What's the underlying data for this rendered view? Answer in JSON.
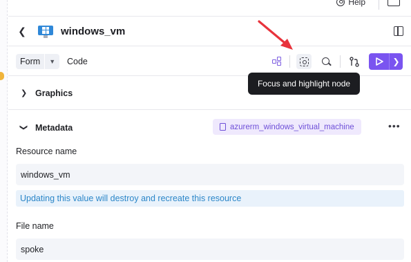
{
  "topbar": {
    "help_label": "Help"
  },
  "header": {
    "title": "windows_vm"
  },
  "toolbar": {
    "form_label": "Form",
    "code_label": "Code"
  },
  "tooltip": {
    "text": "Focus and highlight node"
  },
  "sections": {
    "graphics": {
      "title": "Graphics"
    },
    "metadata": {
      "title": "Metadata",
      "resource_type": "azurerm_windows_virtual_machine"
    }
  },
  "fields": {
    "resource_name": {
      "label": "Resource name",
      "value": "windows_vm",
      "note": "Updating this value will destroy and recreate this resource"
    },
    "file_name": {
      "label": "File name",
      "value": "spoke"
    }
  },
  "colors": {
    "accent": "#7a54f0",
    "chip_text": "#6e4fd8",
    "note_text": "#2b86c8",
    "arrow": "#e8333c"
  },
  "icons": [
    "help-icon",
    "inbox-icon",
    "back-icon",
    "windows-vm-icon",
    "panel-toggle-icon",
    "chevron-down-icon",
    "graph-icon",
    "focus-icon",
    "search-icon",
    "branch-icon",
    "play-icon",
    "chevron-right-icon",
    "document-icon",
    "more-icon"
  ]
}
